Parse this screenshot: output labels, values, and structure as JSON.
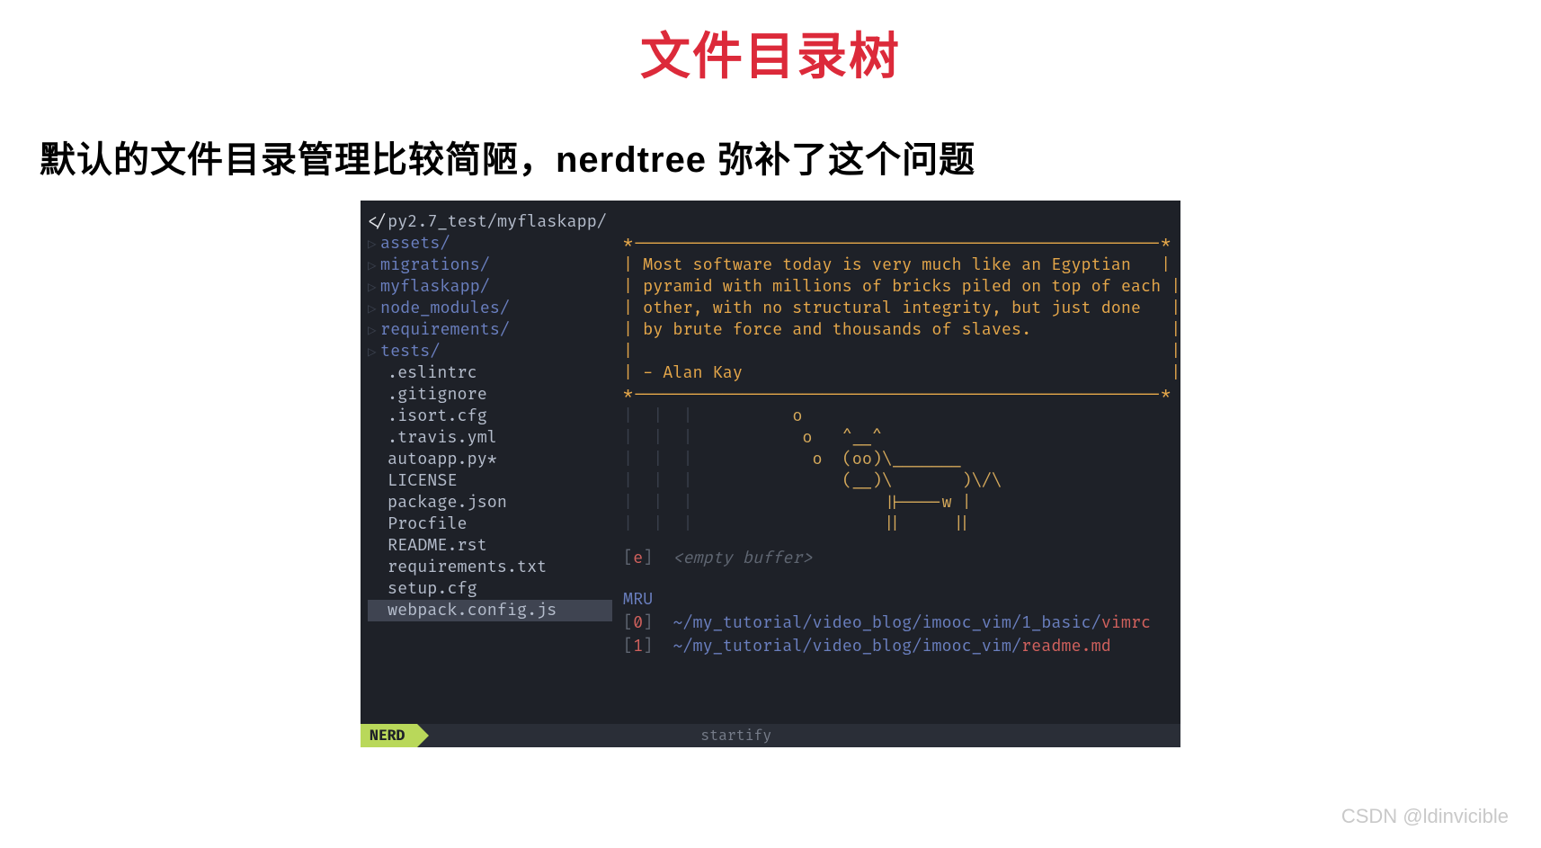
{
  "title": "文件目录树",
  "subtitle": "默认的文件目录管理比较简陋，nerdtree 弥补了这个问题",
  "nerdtree": {
    "root_prefix": "</",
    "root_path": "py2.7_test/myflaskapp/",
    "dirs": [
      "assets/",
      "migrations/",
      "myflaskapp/",
      "node_modules/",
      "requirements/",
      "tests/"
    ],
    "files": [
      ".eslintrc",
      ".gitignore",
      ".isort.cfg",
      ".travis.yml",
      "autoapp.py*",
      "LICENSE",
      "package.json",
      "Procfile",
      "README.rst",
      "requirements.txt",
      "setup.cfg",
      "webpack.config.js"
    ],
    "selected_index": 11
  },
  "quote": {
    "border_top": "*-----------------------------------------------------*",
    "line1": "| Most software today is very much like an Egyptian   |",
    "line2": "| pyramid with millions of bricks piled on top of each |",
    "line3": "| other, with no structural integrity, but just done   |",
    "line4": "| by brute force and thousands of slaves.              |",
    "blank": "|                                                      |",
    "author": "| - Alan Kay                                           |",
    "border_bot": "*-----------------------------------------------------*"
  },
  "cow": {
    "l1": "        o",
    "l2": "         o   ^__^",
    "l3": "          o  (oo)\\_______",
    "l4": "             (__)\\       )\\/\\",
    "l5": "                 ||----w |",
    "l6": "                 ||     ||"
  },
  "startify": {
    "e_key": "e",
    "empty_label": "<empty buffer>",
    "mru_label": "MRU",
    "mru": [
      {
        "key": "0",
        "prefix": "~",
        "mid": "/my_tutorial/video_blog/imooc_vim/1_basic/",
        "tail": "vimrc"
      },
      {
        "key": "1",
        "prefix": "~",
        "mid": "/my_tutorial/video_blog/imooc_vim/",
        "tail": "readme.md"
      }
    ]
  },
  "statusbar": {
    "mode": "NERD",
    "buffer": "startify"
  },
  "watermark": "CSDN @ldinvicible"
}
